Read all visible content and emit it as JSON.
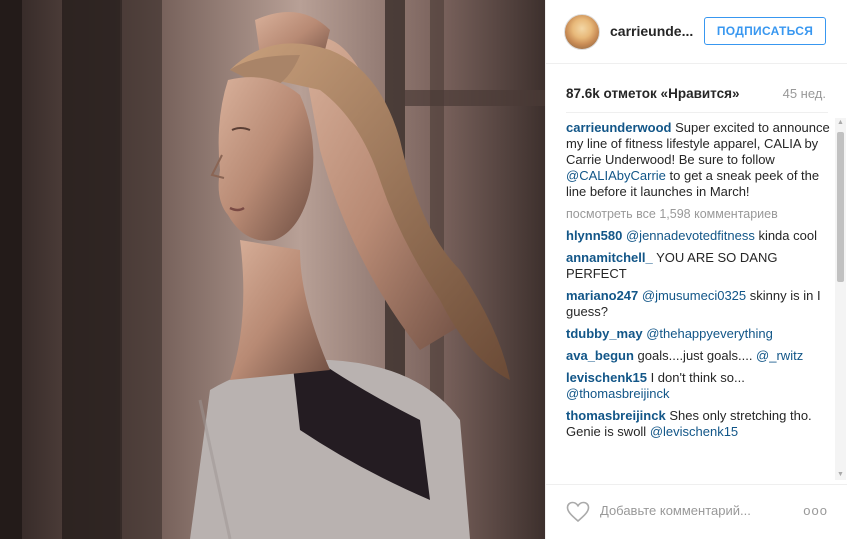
{
  "post": {
    "username": "carrieunde...",
    "follow_label": "ПОДПИСАТЬСЯ",
    "likes": "87.6k отметок «Нравится»",
    "time": "45 нед."
  },
  "caption": {
    "user": "carrieunderwood",
    "text_1": " Super excited to announce my line of fitness lifestyle apparel, CALIA by Carrie Underwood! Be sure to follow ",
    "mention": "@CALIAbyCarrie",
    "text_2": " to get a sneak peek of the line before it launches in March!"
  },
  "view_all": "посмотреть все 1,598 комментариев",
  "comments": [
    {
      "user": "hlynn580",
      "mention": "@jennadevotedfitness",
      "text": " kinda cool"
    },
    {
      "user": "annamitchell_",
      "mention": "",
      "text": " YOU ARE SO DANG PERFECT"
    },
    {
      "user": "mariano247",
      "mention": "@jmusumeci0325",
      "text": " skinny is in I guess?"
    },
    {
      "user": "tdubby_may",
      "mention": "@thehappyeverything",
      "text": ""
    },
    {
      "user": "ava_begun",
      "mention": "",
      "text": " goals....just goals.... ",
      "mention2": "@_rwitz"
    },
    {
      "user": "levischenk15",
      "mention": "",
      "text": " I don't think so... ",
      "mention2": "@thomasbreijinck"
    },
    {
      "user": "thomasbreijinck",
      "mention": "",
      "text": " Shes only stretching tho. Genie is swoll ",
      "mention2": "@levischenk15"
    }
  ],
  "footer": {
    "add_comment_placeholder": "Добавьте комментарий...",
    "more_label": "ooo"
  },
  "icons": {
    "heart": "heart-icon",
    "more": "more-options-icon"
  },
  "colors": {
    "link": "#125688",
    "follow": "#3897f0",
    "muted": "#999999"
  }
}
